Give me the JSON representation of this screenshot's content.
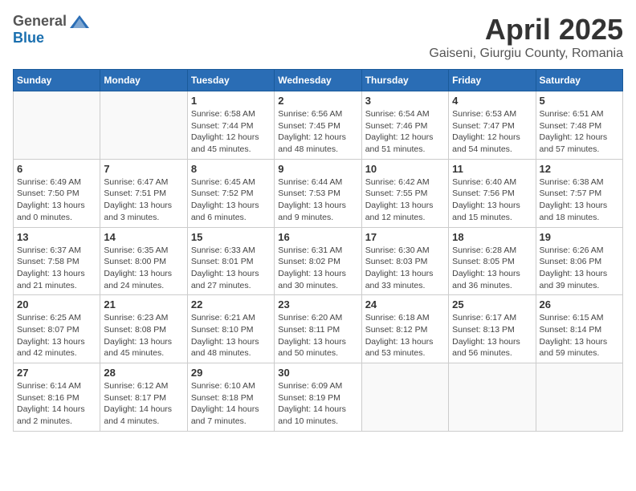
{
  "header": {
    "logo_general": "General",
    "logo_blue": "Blue",
    "month_title": "April 2025",
    "location": "Gaiseni, Giurgiu County, Romania"
  },
  "days_of_week": [
    "Sunday",
    "Monday",
    "Tuesday",
    "Wednesday",
    "Thursday",
    "Friday",
    "Saturday"
  ],
  "weeks": [
    [
      {
        "day": "",
        "info": ""
      },
      {
        "day": "",
        "info": ""
      },
      {
        "day": "1",
        "info": "Sunrise: 6:58 AM\nSunset: 7:44 PM\nDaylight: 12 hours\nand 45 minutes."
      },
      {
        "day": "2",
        "info": "Sunrise: 6:56 AM\nSunset: 7:45 PM\nDaylight: 12 hours\nand 48 minutes."
      },
      {
        "day": "3",
        "info": "Sunrise: 6:54 AM\nSunset: 7:46 PM\nDaylight: 12 hours\nand 51 minutes."
      },
      {
        "day": "4",
        "info": "Sunrise: 6:53 AM\nSunset: 7:47 PM\nDaylight: 12 hours\nand 54 minutes."
      },
      {
        "day": "5",
        "info": "Sunrise: 6:51 AM\nSunset: 7:48 PM\nDaylight: 12 hours\nand 57 minutes."
      }
    ],
    [
      {
        "day": "6",
        "info": "Sunrise: 6:49 AM\nSunset: 7:50 PM\nDaylight: 13 hours\nand 0 minutes."
      },
      {
        "day": "7",
        "info": "Sunrise: 6:47 AM\nSunset: 7:51 PM\nDaylight: 13 hours\nand 3 minutes."
      },
      {
        "day": "8",
        "info": "Sunrise: 6:45 AM\nSunset: 7:52 PM\nDaylight: 13 hours\nand 6 minutes."
      },
      {
        "day": "9",
        "info": "Sunrise: 6:44 AM\nSunset: 7:53 PM\nDaylight: 13 hours\nand 9 minutes."
      },
      {
        "day": "10",
        "info": "Sunrise: 6:42 AM\nSunset: 7:55 PM\nDaylight: 13 hours\nand 12 minutes."
      },
      {
        "day": "11",
        "info": "Sunrise: 6:40 AM\nSunset: 7:56 PM\nDaylight: 13 hours\nand 15 minutes."
      },
      {
        "day": "12",
        "info": "Sunrise: 6:38 AM\nSunset: 7:57 PM\nDaylight: 13 hours\nand 18 minutes."
      }
    ],
    [
      {
        "day": "13",
        "info": "Sunrise: 6:37 AM\nSunset: 7:58 PM\nDaylight: 13 hours\nand 21 minutes."
      },
      {
        "day": "14",
        "info": "Sunrise: 6:35 AM\nSunset: 8:00 PM\nDaylight: 13 hours\nand 24 minutes."
      },
      {
        "day": "15",
        "info": "Sunrise: 6:33 AM\nSunset: 8:01 PM\nDaylight: 13 hours\nand 27 minutes."
      },
      {
        "day": "16",
        "info": "Sunrise: 6:31 AM\nSunset: 8:02 PM\nDaylight: 13 hours\nand 30 minutes."
      },
      {
        "day": "17",
        "info": "Sunrise: 6:30 AM\nSunset: 8:03 PM\nDaylight: 13 hours\nand 33 minutes."
      },
      {
        "day": "18",
        "info": "Sunrise: 6:28 AM\nSunset: 8:05 PM\nDaylight: 13 hours\nand 36 minutes."
      },
      {
        "day": "19",
        "info": "Sunrise: 6:26 AM\nSunset: 8:06 PM\nDaylight: 13 hours\nand 39 minutes."
      }
    ],
    [
      {
        "day": "20",
        "info": "Sunrise: 6:25 AM\nSunset: 8:07 PM\nDaylight: 13 hours\nand 42 minutes."
      },
      {
        "day": "21",
        "info": "Sunrise: 6:23 AM\nSunset: 8:08 PM\nDaylight: 13 hours\nand 45 minutes."
      },
      {
        "day": "22",
        "info": "Sunrise: 6:21 AM\nSunset: 8:10 PM\nDaylight: 13 hours\nand 48 minutes."
      },
      {
        "day": "23",
        "info": "Sunrise: 6:20 AM\nSunset: 8:11 PM\nDaylight: 13 hours\nand 50 minutes."
      },
      {
        "day": "24",
        "info": "Sunrise: 6:18 AM\nSunset: 8:12 PM\nDaylight: 13 hours\nand 53 minutes."
      },
      {
        "day": "25",
        "info": "Sunrise: 6:17 AM\nSunset: 8:13 PM\nDaylight: 13 hours\nand 56 minutes."
      },
      {
        "day": "26",
        "info": "Sunrise: 6:15 AM\nSunset: 8:14 PM\nDaylight: 13 hours\nand 59 minutes."
      }
    ],
    [
      {
        "day": "27",
        "info": "Sunrise: 6:14 AM\nSunset: 8:16 PM\nDaylight: 14 hours\nand 2 minutes."
      },
      {
        "day": "28",
        "info": "Sunrise: 6:12 AM\nSunset: 8:17 PM\nDaylight: 14 hours\nand 4 minutes."
      },
      {
        "day": "29",
        "info": "Sunrise: 6:10 AM\nSunset: 8:18 PM\nDaylight: 14 hours\nand 7 minutes."
      },
      {
        "day": "30",
        "info": "Sunrise: 6:09 AM\nSunset: 8:19 PM\nDaylight: 14 hours\nand 10 minutes."
      },
      {
        "day": "",
        "info": ""
      },
      {
        "day": "",
        "info": ""
      },
      {
        "day": "",
        "info": ""
      }
    ]
  ]
}
